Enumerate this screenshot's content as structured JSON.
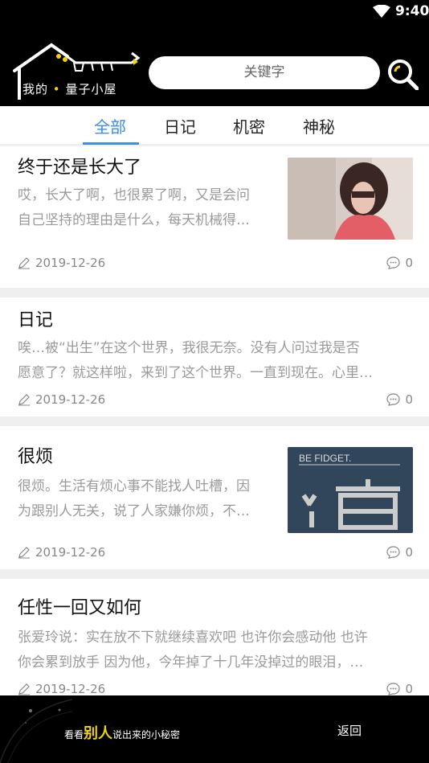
{
  "status_bar": {
    "time": "9:40"
  },
  "header": {
    "logo_text_1": "我的",
    "logo_text_2": "量子小屋",
    "search_placeholder": "关键字"
  },
  "tabs": [
    {
      "label": "全部",
      "active": true
    },
    {
      "label": "日记",
      "active": false
    },
    {
      "label": "机密",
      "active": false
    },
    {
      "label": "神秘",
      "active": false
    }
  ],
  "posts": [
    {
      "title": "终于还是长大了",
      "excerpt_line1": "哎，长大了啊，也很累了啊，又是会问",
      "excerpt_line2": "自己坚持的理由是什么，每天机械得…",
      "date": "2019-12-26",
      "comments": "0"
    },
    {
      "title": "日记",
      "excerpt_line1": "唉…被“出生”在这个世界，我很无奈。没有人问过我是否",
      "excerpt_line2": "愿意了？就这样啦，来到了这个世界。一直到现在。心里…",
      "date": "2019-12-26",
      "comments": "0"
    },
    {
      "title": "很烦",
      "excerpt_line1": "很烦。生活有烦心事不能找人吐槽，因",
      "excerpt_line2": "为跟别人无关，说了人家嫌你烦，不…",
      "date": "2019-12-26",
      "comments": "0",
      "thumb_text": "BE FIDGET."
    },
    {
      "title": "任性一回又如何",
      "excerpt_line1": "张爱玲说：实在放不下就继续喜欢吧 也许你会感动他 也许",
      "excerpt_line2": "你会累到放手 因为他，今年掉了十几年没掉过的眼泪，…",
      "date": "2019-12-26",
      "comments": "0"
    }
  ],
  "footer": {
    "slogan_pre": "看看",
    "slogan_em": "别人",
    "slogan_post": "说出来的小秘密",
    "back_label": "返回"
  }
}
